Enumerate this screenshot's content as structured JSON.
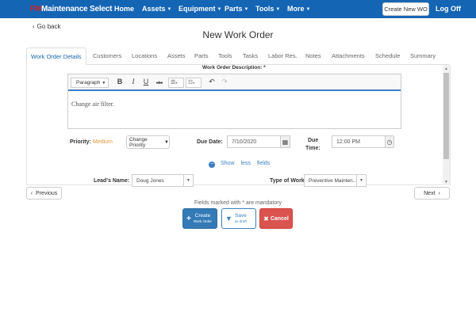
{
  "navbar": {
    "brand_prefix": "FM",
    "brand_name": "Maintenance Select",
    "items": [
      {
        "label": "Home",
        "has_caret": false
      },
      {
        "label": "Assets",
        "has_caret": true
      },
      {
        "label": "Equipment",
        "has_caret": true
      },
      {
        "label": "Parts",
        "has_caret": true
      },
      {
        "label": "Tools",
        "has_caret": true
      },
      {
        "label": "More",
        "has_caret": true
      }
    ],
    "create_button": "Create New WO",
    "logoff": "Log Off"
  },
  "go_back": "Go back",
  "page_title": "New Work Order",
  "tabs": [
    "Work Order Details",
    "Customers",
    "Locations",
    "Assets",
    "Parts",
    "Tools",
    "Tasks",
    "Labor Res.",
    "Notes",
    "Attachments",
    "Schedule",
    "Summary"
  ],
  "form": {
    "description_label": "Work Order Description: *",
    "editor": {
      "paragraph_select": "Paragraph",
      "bold": "B",
      "italic": "I",
      "underline": "U",
      "strike": "abc",
      "content": "Change air filter."
    },
    "priority_label": "Priority:",
    "priority_value": "Medium",
    "change_priority": "Change Priority",
    "due_date_label": "Due Date:",
    "due_date": "7/10/2020",
    "due_time_label_1": "Due",
    "due_time_label_2": "Time:",
    "due_time": "12:00 PM",
    "show_less": [
      "Show",
      "less",
      "fields"
    ],
    "lead_label": "Lead's Name:",
    "lead_value": "Doug Jones",
    "type_label": "Type of Work:",
    "type_value": "Preventive Mainten..."
  },
  "pager": {
    "previous": "Previous",
    "next": "Next"
  },
  "mandatory_note": "Fields marked with * are mandatory",
  "actions": {
    "create_main": "Create",
    "create_sub": "Work Order",
    "save_main": "Save",
    "save_sub": "as draft",
    "cancel": "Cancel"
  },
  "colors": {
    "navbar": "#1565b5",
    "brand_accent": "#d42027",
    "priority_medium": "#e8963c",
    "create_btn": "#337ab7",
    "cancel_btn": "#d9534f"
  }
}
